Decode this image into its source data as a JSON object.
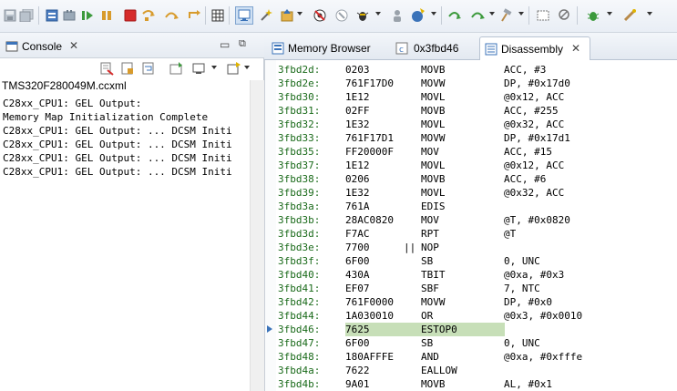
{
  "console": {
    "tab_label": "Console",
    "title": "TMS320F280049M.ccxml",
    "lines": [
      "C28xx_CPU1: GEL Output:",
      "Memory Map Initialization Complete",
      "C28xx_CPU1: GEL Output: ... DCSM Initi",
      "C28xx_CPU1: GEL Output: ... DCSM Initi",
      "C28xx_CPU1: GEL Output: ... DCSM Initi",
      "C28xx_CPU1: GEL Output: ... DCSM Initi"
    ]
  },
  "editor": {
    "tabs": [
      {
        "label": "Memory Browser"
      },
      {
        "label": "0x3fbd46"
      },
      {
        "label": "Disassembly"
      }
    ],
    "disassembly": [
      {
        "addr": "3fbd2d:",
        "hex": "0203",
        "par": "",
        "mnemonic": "MOVB",
        "operands": "ACC, #3"
      },
      {
        "addr": "3fbd2e:",
        "hex": "761F17D0",
        "par": "",
        "mnemonic": "MOVW",
        "operands": "DP, #0x17d0"
      },
      {
        "addr": "3fbd30:",
        "hex": "1E12",
        "par": "",
        "mnemonic": "MOVL",
        "operands": "@0x12, ACC"
      },
      {
        "addr": "3fbd31:",
        "hex": "02FF",
        "par": "",
        "mnemonic": "MOVB",
        "operands": "ACC, #255"
      },
      {
        "addr": "3fbd32:",
        "hex": "1E32",
        "par": "",
        "mnemonic": "MOVL",
        "operands": "@0x32, ACC"
      },
      {
        "addr": "3fbd33:",
        "hex": "761F17D1",
        "par": "",
        "mnemonic": "MOVW",
        "operands": "DP, #0x17d1"
      },
      {
        "addr": "3fbd35:",
        "hex": "FF20000F",
        "par": "",
        "mnemonic": "MOV",
        "operands": "ACC, #15"
      },
      {
        "addr": "3fbd37:",
        "hex": "1E12",
        "par": "",
        "mnemonic": "MOVL",
        "operands": "@0x12, ACC"
      },
      {
        "addr": "3fbd38:",
        "hex": "0206",
        "par": "",
        "mnemonic": "MOVB",
        "operands": "ACC, #6"
      },
      {
        "addr": "3fbd39:",
        "hex": "1E32",
        "par": "",
        "mnemonic": "MOVL",
        "operands": "@0x32, ACC"
      },
      {
        "addr": "3fbd3a:",
        "hex": "761A",
        "par": "",
        "mnemonic": "EDIS",
        "operands": ""
      },
      {
        "addr": "3fbd3b:",
        "hex": "28AC0820",
        "par": "",
        "mnemonic": "MOV",
        "operands": "@T, #0x0820"
      },
      {
        "addr": "3fbd3d:",
        "hex": "F7AC",
        "par": "",
        "mnemonic": "RPT",
        "operands": "@T"
      },
      {
        "addr": "3fbd3e:",
        "hex": "7700",
        "par": "||",
        "mnemonic": "NOP",
        "operands": ""
      },
      {
        "addr": "3fbd3f:",
        "hex": "6F00",
        "par": "",
        "mnemonic": "SB",
        "operands": "0, UNC"
      },
      {
        "addr": "3fbd40:",
        "hex": "430A",
        "par": "",
        "mnemonic": "TBIT",
        "operands": "@0xa, #0x3"
      },
      {
        "addr": "3fbd41:",
        "hex": "EF07",
        "par": "",
        "mnemonic": "SBF",
        "operands": "7, NTC"
      },
      {
        "addr": "3fbd42:",
        "hex": "761F0000",
        "par": "",
        "mnemonic": "MOVW",
        "operands": "DP, #0x0"
      },
      {
        "addr": "3fbd44:",
        "hex": "1A030010",
        "par": "",
        "mnemonic": "OR",
        "operands": "@0x3, #0x0010"
      },
      {
        "addr": "3fbd46:",
        "hex": "7625",
        "par": "",
        "mnemonic": "ESTOP0",
        "operands": "",
        "current": true
      },
      {
        "addr": "3fbd47:",
        "hex": "6F00",
        "par": "",
        "mnemonic": "SB",
        "operands": "0, UNC"
      },
      {
        "addr": "3fbd48:",
        "hex": "180AFFFE",
        "par": "",
        "mnemonic": "AND",
        "operands": "@0xa, #0xfffe"
      },
      {
        "addr": "3fbd4a:",
        "hex": "7622",
        "par": "",
        "mnemonic": "EALLOW",
        "operands": ""
      },
      {
        "addr": "3fbd4b:",
        "hex": "9A01",
        "par": "",
        "mnemonic": "MOVB",
        "operands": "AL, #0x1"
      }
    ]
  },
  "colors": {
    "address": "#1a6a1a",
    "current_line": "#c7dfb8",
    "accent": "#3b73b9"
  }
}
